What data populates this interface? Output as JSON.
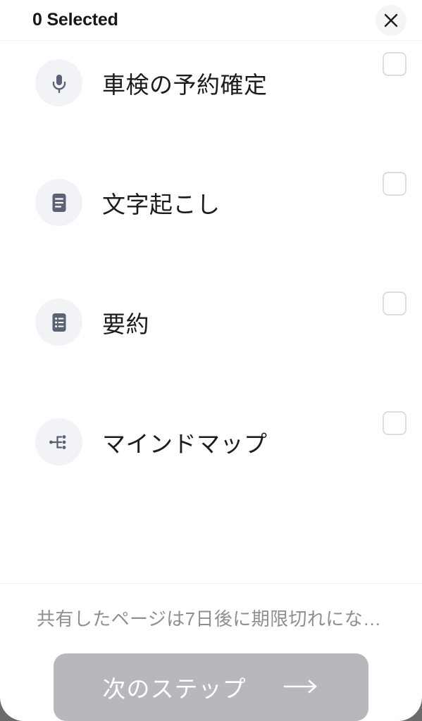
{
  "header": {
    "title": "0 Selected",
    "close_icon": "close-icon"
  },
  "options": [
    {
      "label": "車検の予約確定",
      "icon": "microphone-icon",
      "checked": false
    },
    {
      "label": "文字起こし",
      "icon": "transcript-document-icon",
      "checked": false
    },
    {
      "label": "要約",
      "icon": "summary-list-icon",
      "checked": false
    },
    {
      "label": "マインドマップ",
      "icon": "mind-map-icon",
      "checked": false
    }
  ],
  "footer": {
    "note": "共有したページは7日後に期限切れにな…",
    "next_step_label": "次のステップ",
    "next_step_arrow_icon": "arrow-right-icon"
  },
  "colors": {
    "sheet_background": "#ffffff",
    "backdrop": "#6b6b6b",
    "title_text": "#17171a",
    "label_text": "#1c1c1e",
    "note_text": "#8e8e93",
    "icon_circle": "#f2f3f6",
    "icon_glyph": "#5b6275",
    "checkbox_border": "#dcdde1",
    "button_disabled": "#b6b8bb",
    "button_label": "#ffffff",
    "divider": "#f1f1f3"
  }
}
